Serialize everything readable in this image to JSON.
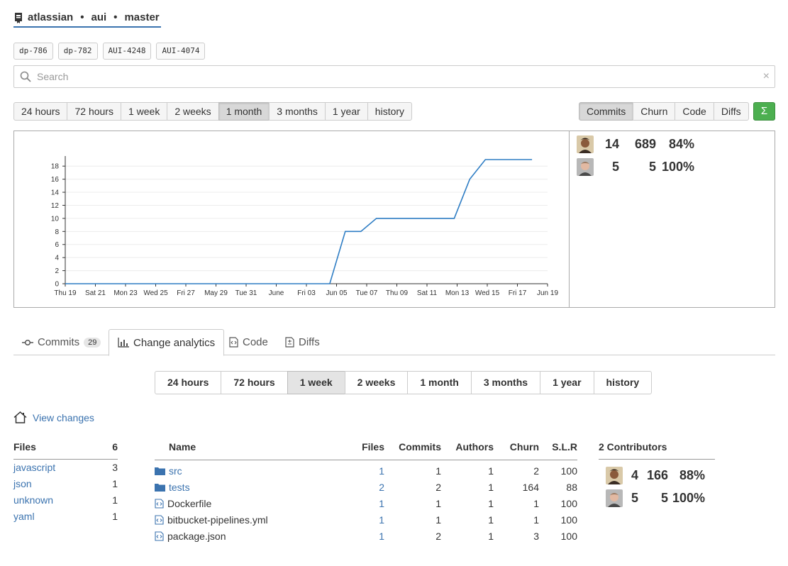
{
  "repo": {
    "owner": "atlassian",
    "name": "aui",
    "branch": "master",
    "separator": "•"
  },
  "branch_tags": [
    "dp-786",
    "dp-782",
    "AUI-4248",
    "AUI-4074"
  ],
  "search": {
    "placeholder": "Search",
    "value": "",
    "clear": "×"
  },
  "range_top": {
    "items": [
      "24 hours",
      "72 hours",
      "1 week",
      "2 weeks",
      "1 month",
      "3 months",
      "1 year",
      "history"
    ],
    "active": "1 month"
  },
  "metrics": {
    "items": [
      "Commits",
      "Churn",
      "Code",
      "Diffs"
    ],
    "active": "Commits",
    "sigma": "Σ",
    "sigma_color": "#4caf50"
  },
  "top_contributors": [
    {
      "count": "14",
      "churn": "689",
      "pct": "84%"
    },
    {
      "count": "5",
      "churn": "5",
      "pct": "100%"
    }
  ],
  "chart_data": {
    "type": "line",
    "x_ticks": [
      "Thu 19",
      "Sat 21",
      "Mon 23",
      "Wed 25",
      "Fri 27",
      "May 29",
      "Tue 31",
      "June",
      "Fri 03",
      "Jun 05",
      "Tue 07",
      "Thu 09",
      "Sat 11",
      "Mon 13",
      "Wed 15",
      "Fri 17",
      "Jun 19"
    ],
    "y_ticks": [
      0,
      2,
      4,
      6,
      8,
      10,
      12,
      14,
      16,
      18
    ],
    "ylim": [
      0,
      19
    ],
    "xlim": [
      "2016-05-19",
      "2016-06-19"
    ],
    "series": [
      {
        "color": "#2e7dc4",
        "x": [
          "2016-05-19",
          "2016-06-05",
          "2016-06-06",
          "2016-06-07",
          "2016-06-08",
          "2016-06-13",
          "2016-06-14",
          "2016-06-15",
          "2016-06-18"
        ],
        "y": [
          0,
          0,
          8,
          8,
          10,
          10,
          16,
          19,
          19
        ]
      }
    ],
    "grid": true
  },
  "tabs": [
    {
      "label": "Commits",
      "badge": "29",
      "icon": "commit-icon"
    },
    {
      "label": "Change analytics",
      "icon": "bar-chart-icon"
    },
    {
      "label": "Code",
      "icon": "code-file-icon"
    },
    {
      "label": "Diffs",
      "icon": "diff-file-icon"
    }
  ],
  "active_tab": "Change analytics",
  "range_bottom": {
    "items": [
      "24 hours",
      "72 hours",
      "1 week",
      "2 weeks",
      "1 month",
      "3 months",
      "1 year",
      "history"
    ],
    "active": "1 week"
  },
  "view_changes": "View changes",
  "files_panel": {
    "header": "Files",
    "total": "6",
    "rows": [
      {
        "type": "javascript",
        "count": "3"
      },
      {
        "type": "json",
        "count": "1"
      },
      {
        "type": "unknown",
        "count": "1"
      },
      {
        "type": "yaml",
        "count": "1"
      }
    ]
  },
  "table": {
    "columns": [
      "Name",
      "Files",
      "Commits",
      "Authors",
      "Churn",
      "S.L.R"
    ],
    "rows": [
      {
        "kind": "folder",
        "name": "src",
        "files": "1",
        "commits": "1",
        "authors": "1",
        "churn": "2",
        "slr": "100"
      },
      {
        "kind": "folder",
        "name": "tests",
        "files": "2",
        "commits": "2",
        "authors": "1",
        "churn": "164",
        "slr": "88"
      },
      {
        "kind": "file",
        "name": "Dockerfile",
        "files": "1",
        "commits": "1",
        "authors": "1",
        "churn": "1",
        "slr": "100"
      },
      {
        "kind": "file",
        "name": "bitbucket-pipelines.yml",
        "files": "1",
        "commits": "1",
        "authors": "1",
        "churn": "1",
        "slr": "100"
      },
      {
        "kind": "file",
        "name": "package.json",
        "files": "1",
        "commits": "2",
        "authors": "1",
        "churn": "3",
        "slr": "100"
      }
    ]
  },
  "contributors_panel": {
    "header": "2 Contributors",
    "rows": [
      {
        "count": "4",
        "churn": "166",
        "pct": "88%"
      },
      {
        "count": "5",
        "churn": "5",
        "pct": "100%"
      }
    ]
  }
}
